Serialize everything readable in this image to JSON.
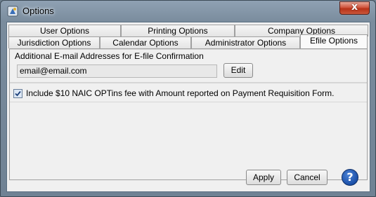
{
  "window": {
    "title": "Options",
    "close_glyph": "x"
  },
  "tabs": {
    "row1": [
      "User Options",
      "Printing Options",
      "Company Options"
    ],
    "row2": [
      "Jurisdiction Options",
      "Calendar Options",
      "Administrator Options",
      "Efile Options"
    ],
    "active": "Efile Options"
  },
  "efile": {
    "email_group_label": "Additional E-mail Addresses for E-file Confirmation",
    "email_value": "email@email.com",
    "edit_label": "Edit",
    "fee_checkbox_label": "Include $10 NAIC OPTins fee with Amount reported on Payment Requisition Form.",
    "fee_checked": true
  },
  "footer": {
    "apply_label": "Apply",
    "cancel_label": "Cancel",
    "help_glyph": "?"
  },
  "icons": {
    "app": "app-icon",
    "help": "help-icon",
    "check": "checkmark-icon"
  },
  "colors": {
    "title_bar": "#7a8c9d",
    "close": "#c9452a",
    "help": "#1a4fa8"
  }
}
